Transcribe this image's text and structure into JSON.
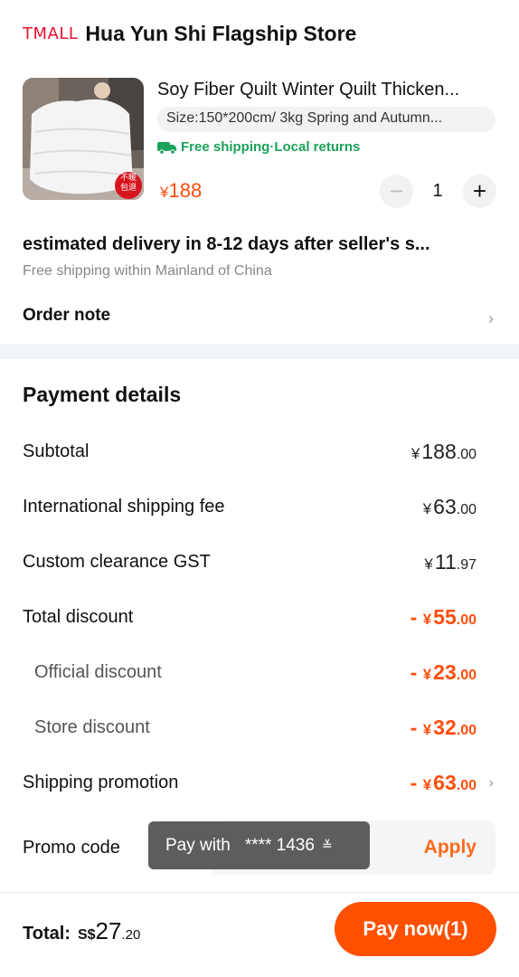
{
  "store": {
    "logo_text": "TMALL",
    "name": "Hua Yun Shi Flagship Store"
  },
  "product": {
    "title": "Soy Fiber Quilt Winter Quilt Thicken...",
    "sku": "Size:150*200cm/ 3kg Spring and Autumn...",
    "shipping": "Free shipping·Local returns",
    "thumb_badge": "不暖包退",
    "price_currency": "¥",
    "price": "188",
    "qty_minus": "−",
    "quantity": "1",
    "qty_plus": "+"
  },
  "delivery": {
    "title": "estimated delivery in  8-12  days after seller's s...",
    "subtitle": "Free shipping within Mainland of China"
  },
  "order_note": {
    "label": "Order note",
    "chevron": "›"
  },
  "payment": {
    "title": "Payment details",
    "rows": [
      {
        "label": "Subtotal",
        "sign": "",
        "currency": "¥",
        "int": "188",
        "dec": ".00"
      },
      {
        "label": "International shipping fee",
        "sign": "",
        "currency": "¥",
        "int": "63",
        "dec": ".00"
      },
      {
        "label": "Custom clearance GST",
        "sign": "",
        "currency": "¥",
        "int": "11",
        "dec": ".97"
      },
      {
        "label": "Total discount",
        "sign": "- ",
        "currency": "¥",
        "int": "55",
        "dec": ".00"
      },
      {
        "label": "Official discount",
        "sign": "- ",
        "currency": "¥",
        "int": "23",
        "dec": ".00"
      },
      {
        "label": "Store discount",
        "sign": "- ",
        "currency": "¥",
        "int": "32",
        "dec": ".00"
      },
      {
        "label": "Shipping promotion",
        "sign": "- ",
        "currency": "¥",
        "int": "63",
        "dec": ".00",
        "chevron": "›"
      }
    ]
  },
  "promo": {
    "label": "Promo code",
    "apply": "Apply",
    "paywith_label": "Pay with",
    "paywith_card": "**** 1436",
    "paywith_dropdown": "≚"
  },
  "footer": {
    "total_label": "Total:",
    "currency": "S$",
    "int": "27",
    "dec": ".20",
    "pay_button": "Pay now(1)"
  },
  "colors": {
    "accent": "#ff5000",
    "discount": "#ff4d0c",
    "tmall_red": "#e8112d",
    "shipping_green": "#1aa25a"
  }
}
